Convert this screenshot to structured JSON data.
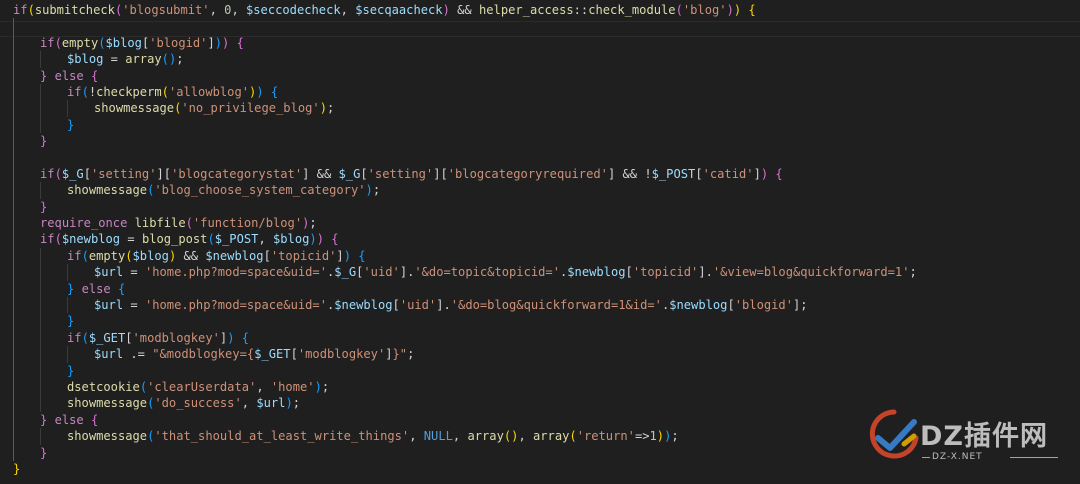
{
  "editor": {
    "language": "php",
    "lines": [
      {
        "indent": 0,
        "tokens": [
          [
            "kw",
            "if"
          ],
          [
            "p1",
            "("
          ],
          [
            "fn",
            "submitcheck"
          ],
          [
            "p2",
            "("
          ],
          [
            "st",
            "'blogsubmit'"
          ],
          [
            "op",
            ", "
          ],
          [
            "nm",
            "0"
          ],
          [
            "op",
            ", "
          ],
          [
            "vr",
            "$seccodecheck"
          ],
          [
            "op",
            ", "
          ],
          [
            "vr",
            "$secqaacheck"
          ],
          [
            "p2",
            ")"
          ],
          [
            "op",
            " && "
          ],
          [
            "fn",
            "helper_access"
          ],
          [
            "op",
            "::"
          ],
          [
            "fn",
            "check_module"
          ],
          [
            "p2",
            "("
          ],
          [
            "st",
            "'blog'"
          ],
          [
            "p2",
            ")"
          ],
          [
            "p1",
            ")"
          ],
          [
            "op",
            " "
          ],
          [
            "p1",
            "{"
          ]
        ]
      },
      {
        "indent": 1,
        "tokens": []
      },
      {
        "indent": 1,
        "tokens": [
          [
            "kw",
            "if"
          ],
          [
            "p2",
            "("
          ],
          [
            "fn",
            "empty"
          ],
          [
            "p3",
            "("
          ],
          [
            "vr",
            "$blog"
          ],
          [
            "op",
            "["
          ],
          [
            "st",
            "'blogid'"
          ],
          [
            "op",
            "]"
          ],
          [
            "p3",
            ")"
          ],
          [
            "p2",
            ")"
          ],
          [
            "op",
            " "
          ],
          [
            "p2",
            "{"
          ]
        ]
      },
      {
        "indent": 2,
        "tokens": [
          [
            "vr",
            "$blog"
          ],
          [
            "op",
            " = "
          ],
          [
            "fn",
            "array"
          ],
          [
            "p3",
            "("
          ],
          [
            "p3",
            ")"
          ],
          [
            "op",
            ";"
          ]
        ]
      },
      {
        "indent": 1,
        "tokens": [
          [
            "p2",
            "}"
          ],
          [
            "op",
            " "
          ],
          [
            "kw",
            "else"
          ],
          [
            "op",
            " "
          ],
          [
            "p2",
            "{"
          ]
        ]
      },
      {
        "indent": 2,
        "tokens": [
          [
            "kw",
            "if"
          ],
          [
            "p3",
            "("
          ],
          [
            "op",
            "!"
          ],
          [
            "fn",
            "checkperm"
          ],
          [
            "p1",
            "("
          ],
          [
            "st",
            "'allowblog'"
          ],
          [
            "p1",
            ")"
          ],
          [
            "p3",
            ")"
          ],
          [
            "op",
            " "
          ],
          [
            "p3",
            "{"
          ]
        ]
      },
      {
        "indent": 3,
        "tokens": [
          [
            "fn",
            "showmessage"
          ],
          [
            "p1",
            "("
          ],
          [
            "st",
            "'no_privilege_blog'"
          ],
          [
            "p1",
            ")"
          ],
          [
            "op",
            ";"
          ]
        ]
      },
      {
        "indent": 2,
        "tokens": [
          [
            "p3",
            "}"
          ]
        ]
      },
      {
        "indent": 1,
        "tokens": [
          [
            "p2",
            "}"
          ]
        ]
      },
      {
        "indent": 1,
        "tokens": []
      },
      {
        "indent": 1,
        "tokens": [
          [
            "kw",
            "if"
          ],
          [
            "p2",
            "("
          ],
          [
            "vr",
            "$_G"
          ],
          [
            "op",
            "["
          ],
          [
            "st",
            "'setting'"
          ],
          [
            "op",
            "]["
          ],
          [
            "st",
            "'blogcategorystat'"
          ],
          [
            "op",
            "] && "
          ],
          [
            "vr",
            "$_G"
          ],
          [
            "op",
            "["
          ],
          [
            "st",
            "'setting'"
          ],
          [
            "op",
            "]["
          ],
          [
            "st",
            "'blogcategoryrequired'"
          ],
          [
            "op",
            "] && !"
          ],
          [
            "vr",
            "$_POST"
          ],
          [
            "op",
            "["
          ],
          [
            "st",
            "'catid'"
          ],
          [
            "op",
            "]"
          ],
          [
            "p2",
            ")"
          ],
          [
            "op",
            " "
          ],
          [
            "p2",
            "{"
          ]
        ]
      },
      {
        "indent": 2,
        "tokens": [
          [
            "fn",
            "showmessage"
          ],
          [
            "p3",
            "("
          ],
          [
            "st",
            "'blog_choose_system_category'"
          ],
          [
            "p3",
            ")"
          ],
          [
            "op",
            ";"
          ]
        ]
      },
      {
        "indent": 1,
        "tokens": [
          [
            "p2",
            "}"
          ]
        ]
      },
      {
        "indent": 1,
        "tokens": [
          [
            "kw",
            "require_once"
          ],
          [
            "op",
            " "
          ],
          [
            "fn",
            "libfile"
          ],
          [
            "p2",
            "("
          ],
          [
            "st",
            "'function/blog'"
          ],
          [
            "p2",
            ")"
          ],
          [
            "op",
            ";"
          ]
        ]
      },
      {
        "indent": 1,
        "tokens": [
          [
            "kw",
            "if"
          ],
          [
            "p2",
            "("
          ],
          [
            "vr",
            "$newblog"
          ],
          [
            "op",
            " = "
          ],
          [
            "fn",
            "blog_post"
          ],
          [
            "p3",
            "("
          ],
          [
            "vr",
            "$_POST"
          ],
          [
            "op",
            ", "
          ],
          [
            "vr",
            "$blog"
          ],
          [
            "p3",
            ")"
          ],
          [
            "p2",
            ")"
          ],
          [
            "op",
            " "
          ],
          [
            "p2",
            "{"
          ]
        ]
      },
      {
        "indent": 2,
        "tokens": [
          [
            "kw",
            "if"
          ],
          [
            "p3",
            "("
          ],
          [
            "fn",
            "empty"
          ],
          [
            "p1",
            "("
          ],
          [
            "vr",
            "$blog"
          ],
          [
            "p1",
            ")"
          ],
          [
            "op",
            " && "
          ],
          [
            "vr",
            "$newblog"
          ],
          [
            "op",
            "["
          ],
          [
            "st",
            "'topicid'"
          ],
          [
            "op",
            "]"
          ],
          [
            "p3",
            ")"
          ],
          [
            "op",
            " "
          ],
          [
            "p3",
            "{"
          ]
        ]
      },
      {
        "indent": 3,
        "tokens": [
          [
            "vr",
            "$url"
          ],
          [
            "op",
            " = "
          ],
          [
            "st",
            "'home.php?mod=space&uid='"
          ],
          [
            "op",
            "."
          ],
          [
            "vr",
            "$_G"
          ],
          [
            "op",
            "["
          ],
          [
            "st",
            "'uid'"
          ],
          [
            "op",
            "]."
          ],
          [
            "st",
            "'&do=topic&topicid='"
          ],
          [
            "op",
            "."
          ],
          [
            "vr",
            "$newblog"
          ],
          [
            "op",
            "["
          ],
          [
            "st",
            "'topicid'"
          ],
          [
            "op",
            "]."
          ],
          [
            "st",
            "'&view=blog&quickforward=1'"
          ],
          [
            "op",
            ";"
          ]
        ]
      },
      {
        "indent": 2,
        "tokens": [
          [
            "p3",
            "}"
          ],
          [
            "op",
            " "
          ],
          [
            "kw",
            "else"
          ],
          [
            "op",
            " "
          ],
          [
            "p3",
            "{"
          ]
        ]
      },
      {
        "indent": 3,
        "tokens": [
          [
            "vr",
            "$url"
          ],
          [
            "op",
            " = "
          ],
          [
            "st",
            "'home.php?mod=space&uid='"
          ],
          [
            "op",
            "."
          ],
          [
            "vr",
            "$newblog"
          ],
          [
            "op",
            "["
          ],
          [
            "st",
            "'uid'"
          ],
          [
            "op",
            "]."
          ],
          [
            "st",
            "'&do=blog&quickforward=1&id='"
          ],
          [
            "op",
            "."
          ],
          [
            "vr",
            "$newblog"
          ],
          [
            "op",
            "["
          ],
          [
            "st",
            "'blogid'"
          ],
          [
            "op",
            "];"
          ]
        ]
      },
      {
        "indent": 2,
        "tokens": [
          [
            "p3",
            "}"
          ]
        ]
      },
      {
        "indent": 2,
        "tokens": [
          [
            "kw",
            "if"
          ],
          [
            "p3",
            "("
          ],
          [
            "vr",
            "$_GET"
          ],
          [
            "op",
            "["
          ],
          [
            "st",
            "'modblogkey'"
          ],
          [
            "op",
            "]"
          ],
          [
            "p3",
            ")"
          ],
          [
            "op",
            " "
          ],
          [
            "p3",
            "{"
          ]
        ]
      },
      {
        "indent": 3,
        "tokens": [
          [
            "vr",
            "$url"
          ],
          [
            "op",
            " .= "
          ],
          [
            "st",
            "\"&modblogkey={"
          ],
          [
            "vr",
            "$_GET"
          ],
          [
            "op",
            "["
          ],
          [
            "st",
            "'modblogkey'"
          ],
          [
            "op",
            "]"
          ],
          [
            "st",
            "}\""
          ],
          [
            "op",
            ";"
          ]
        ]
      },
      {
        "indent": 2,
        "tokens": [
          [
            "p3",
            "}"
          ]
        ]
      },
      {
        "indent": 2,
        "tokens": [
          [
            "fn",
            "dsetcookie"
          ],
          [
            "p3",
            "("
          ],
          [
            "st",
            "'clearUserdata'"
          ],
          [
            "op",
            ", "
          ],
          [
            "st",
            "'home'"
          ],
          [
            "p3",
            ")"
          ],
          [
            "op",
            ";"
          ]
        ]
      },
      {
        "indent": 2,
        "tokens": [
          [
            "fn",
            "showmessage"
          ],
          [
            "p3",
            "("
          ],
          [
            "st",
            "'do_success'"
          ],
          [
            "op",
            ", "
          ],
          [
            "vr",
            "$url"
          ],
          [
            "p3",
            ")"
          ],
          [
            "op",
            ";"
          ]
        ]
      },
      {
        "indent": 1,
        "tokens": [
          [
            "p2",
            "}"
          ],
          [
            "op",
            " "
          ],
          [
            "kw",
            "else"
          ],
          [
            "op",
            " "
          ],
          [
            "p2",
            "{"
          ]
        ]
      },
      {
        "indent": 2,
        "tokens": [
          [
            "fn",
            "showmessage"
          ],
          [
            "p3",
            "("
          ],
          [
            "st",
            "'that_should_at_least_write_things'"
          ],
          [
            "op",
            ", "
          ],
          [
            "cn",
            "NULL"
          ],
          [
            "op",
            ", "
          ],
          [
            "fn",
            "array"
          ],
          [
            "p1",
            "("
          ],
          [
            "p1",
            ")"
          ],
          [
            "op",
            ", "
          ],
          [
            "fn",
            "array"
          ],
          [
            "p1",
            "("
          ],
          [
            "st",
            "'return'"
          ],
          [
            "op",
            "=>"
          ],
          [
            "nm",
            "1"
          ],
          [
            "p1",
            ")"
          ],
          [
            "p3",
            ")"
          ],
          [
            "op",
            ";"
          ]
        ]
      },
      {
        "indent": 1,
        "tokens": [
          [
            "p2",
            "}"
          ]
        ]
      },
      {
        "indent": 0,
        "tokens": [
          [
            "p1",
            "}"
          ]
        ]
      }
    ]
  },
  "watermark": {
    "text": "DZ插件网",
    "url": "DZ-X.NET"
  },
  "colors": {
    "background": "#1f1f1f",
    "keyword": "#c586c0",
    "function": "#dcdcaa",
    "string": "#ce9178",
    "variable": "#9cdcfe",
    "number": "#b5cea8",
    "constant": "#569cd6",
    "bracket1": "#ffd700",
    "bracket2": "#da70d6",
    "bracket3": "#179fff"
  }
}
